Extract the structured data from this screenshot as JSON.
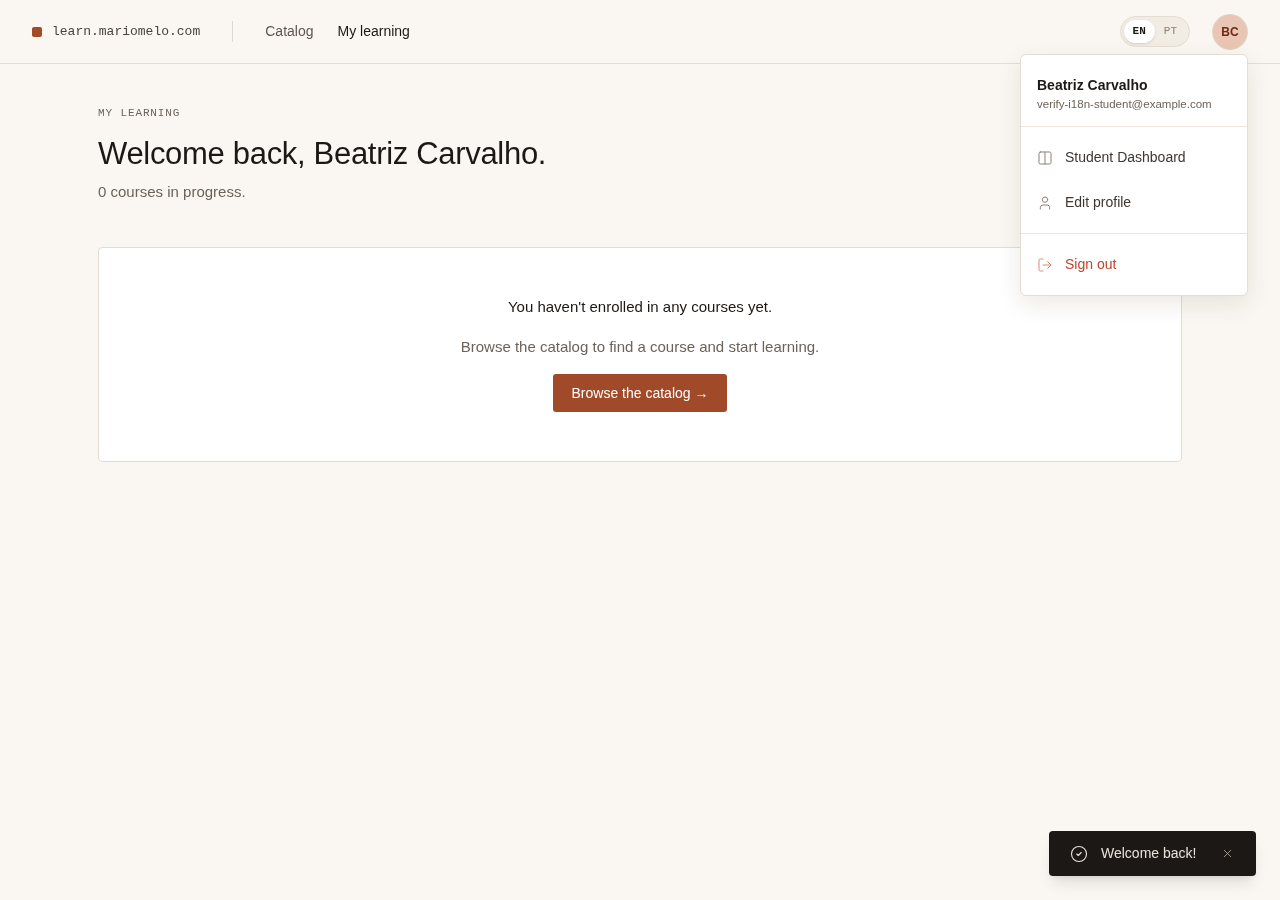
{
  "header": {
    "site": "learn.mariomelo.com",
    "nav": [
      {
        "label": "Catalog",
        "selected": false
      },
      {
        "label": "My learning",
        "selected": true
      }
    ],
    "languages": [
      {
        "label": "EN",
        "selected": true
      },
      {
        "label": "PT",
        "selected": false
      }
    ],
    "avatar": "BC"
  },
  "user_menu": {
    "name": "Beatriz Carvalho",
    "email": "verify-i18n-student@example.com",
    "sections": [
      {
        "items": [
          {
            "label": "Student Dashboard",
            "kind": "dashboard"
          },
          {
            "label": "Edit profile",
            "kind": "profile"
          }
        ]
      },
      {
        "items": [
          {
            "label": "Sign out",
            "kind": "signout"
          }
        ]
      }
    ]
  },
  "page": {
    "eyebrow": "MY LEARNING",
    "title": "Welcome back, Beatriz Carvalho.",
    "subtitle": "0 courses in progress."
  },
  "empty_state": {
    "title": "You haven't enrolled in any courses yet.",
    "text": "Browse the catalog to find a course and start learning.",
    "button": "Browse the catalog →"
  },
  "toast": {
    "message": "Welcome back!"
  }
}
